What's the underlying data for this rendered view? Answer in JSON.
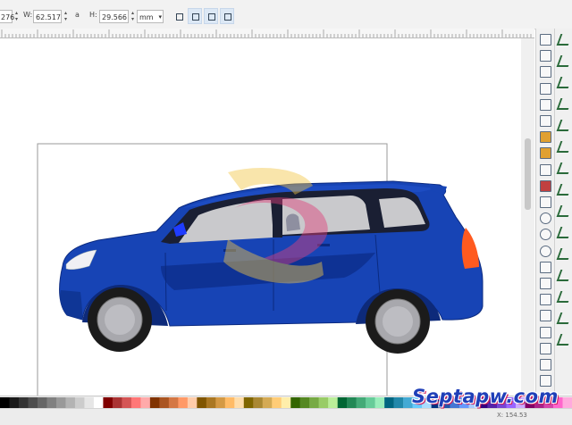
{
  "toolbar": {
    "x_value": "276",
    "w_label": "W:",
    "w_value": "62.517",
    "lock_glyph": "a",
    "h_label": "H:",
    "h_value": "29.566",
    "unit": "mm"
  },
  "status": {
    "coords": "X: 154.53"
  },
  "watermark": {
    "text": "Septapw.com"
  },
  "colors": {
    "car_body": "#1744b5",
    "car_shadow": "#0d2f8e",
    "window_glass": "#c9c9cc",
    "window_frame": "#1a1f33",
    "tail_light": "#ff5a1f",
    "headlight": "#f0f0f4",
    "side_mirror": "#1f3cff",
    "logo_overlay_gold": "#f2c646",
    "logo_overlay_rose": "#e0407a"
  },
  "icons": {
    "commands_bar": [
      "new-document-icon",
      "open-icon",
      "save-icon",
      "print-icon",
      "import-icon",
      "export-icon",
      "undo-icon",
      "redo-icon",
      "copy-icon",
      "cut-icon",
      "paste-icon",
      "zoom-drawing-icon",
      "zoom-selection-icon",
      "zoom-page-icon",
      "duplicate-icon",
      "clone-icon",
      "unlink-clone-icon",
      "text-font-icon",
      "group-icon",
      "ungroup-icon",
      "align-icon",
      "xml-editor-icon"
    ],
    "snap_bar": [
      "snap-toggle-icon",
      "snap-bbox-icon",
      "snap-bbox-edge-icon",
      "snap-bbox-corner-icon",
      "snap-nodes-icon",
      "snap-path-icon",
      "snap-intersection-icon",
      "snap-cusp-icon",
      "snap-smooth-icon",
      "snap-midpoint-icon",
      "snap-center-icon",
      "snap-rotation-icon",
      "snap-page-icon",
      "snap-grid-icon",
      "snap-guide-icon"
    ]
  }
}
